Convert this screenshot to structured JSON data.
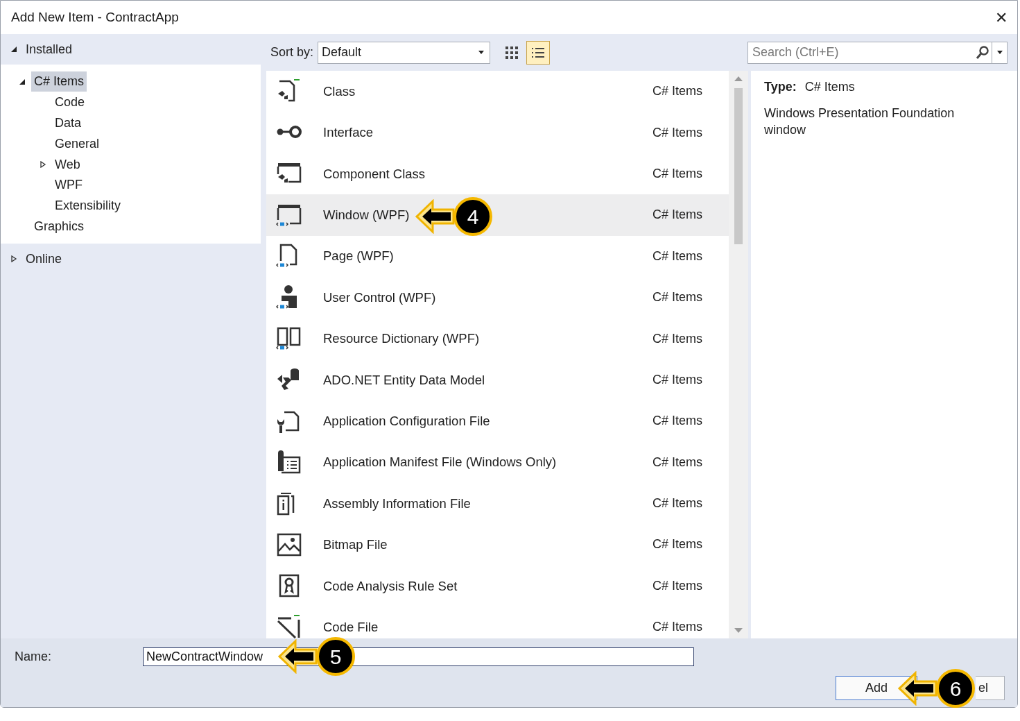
{
  "window": {
    "title": "Add New Item - ContractApp",
    "close": "✕"
  },
  "tree": [
    {
      "label": "Installed",
      "expanded": true,
      "children": [
        {
          "label": "C# Items",
          "expanded": true,
          "selected": true,
          "children": [
            {
              "label": "Code",
              "selected": false
            },
            {
              "label": "Data",
              "selected": false
            },
            {
              "label": "General",
              "selected": false
            },
            {
              "label": "Web",
              "expanded": false,
              "selected": false
            },
            {
              "label": "WPF",
              "selected": false
            },
            {
              "label": "Extensibility",
              "selected": false
            }
          ]
        },
        {
          "label": "Graphics",
          "selected": false
        }
      ]
    },
    {
      "label": "Online",
      "expanded": false
    }
  ],
  "toolbar": {
    "sort_label": "Sort by:",
    "sort_value": "Default",
    "views": [
      {
        "kind": "grid",
        "selected": false
      },
      {
        "kind": "list",
        "selected": true
      }
    ],
    "search_placeholder": "Search (Ctrl+E)"
  },
  "items": [
    {
      "name": "Class",
      "type": "C# Items",
      "selected": false
    },
    {
      "name": "Interface",
      "type": "C# Items",
      "selected": false
    },
    {
      "name": "Component Class",
      "type": "C# Items",
      "selected": false
    },
    {
      "name": "Window (WPF)",
      "type": "C# Items",
      "selected": true
    },
    {
      "name": "Page (WPF)",
      "type": "C# Items",
      "selected": false
    },
    {
      "name": "User Control (WPF)",
      "type": "C# Items",
      "selected": false
    },
    {
      "name": "Resource Dictionary (WPF)",
      "type": "C# Items",
      "selected": false
    },
    {
      "name": "ADO.NET Entity Data Model",
      "type": "C# Items",
      "selected": false
    },
    {
      "name": "Application Configuration File",
      "type": "C# Items",
      "selected": false
    },
    {
      "name": "Application Manifest File (Windows Only)",
      "type": "C# Items",
      "selected": false
    },
    {
      "name": "Assembly Information File",
      "type": "C# Items",
      "selected": false
    },
    {
      "name": "Bitmap File",
      "type": "C# Items",
      "selected": false
    },
    {
      "name": "Code Analysis Rule Set",
      "type": "C# Items",
      "selected": false
    },
    {
      "name": "Code File",
      "type": "C# Items",
      "selected": false
    }
  ],
  "details": {
    "type_label": "Type:",
    "type_value": "C# Items",
    "description": "Windows Presentation Foundation window"
  },
  "name_field": {
    "label": "Name:",
    "value": "NewContractWindow"
  },
  "buttons": [
    {
      "label": "Add"
    },
    {
      "label": "el"
    }
  ],
  "callouts": [
    {
      "number": "4"
    },
    {
      "number": "5"
    },
    {
      "number": "6"
    }
  ]
}
